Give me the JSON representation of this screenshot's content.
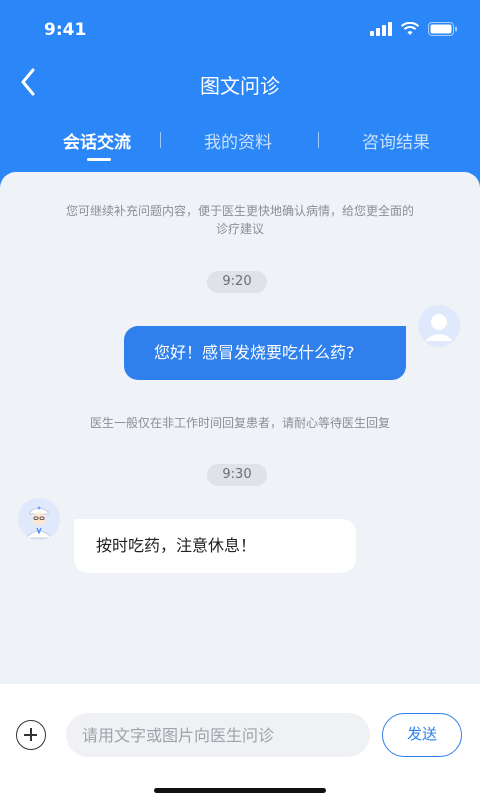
{
  "status_bar": {
    "time": "9:41"
  },
  "nav": {
    "title": "图文问诊"
  },
  "tabs": [
    {
      "label": "会话交流",
      "active": true
    },
    {
      "label": "我的资料",
      "active": false
    },
    {
      "label": "咨询结果",
      "active": false
    }
  ],
  "chat": {
    "notice_top_line1": "您可继续补充问题内容，便于医生更快地确认病情，给您更全面的",
    "notice_top_line2": "诊疗建议",
    "time1": "9:20",
    "user_message": "您好！感冒发烧要吃什么药?",
    "notice_middle": "医生一般仅在非工作时间回复患者，请耐心等待医生回复",
    "time2": "9:30",
    "doctor_message": "按时吃药，注意休息！"
  },
  "input_bar": {
    "placeholder": "请用文字或图片向医生问诊",
    "send_label": "发送"
  },
  "colors": {
    "primary": "#2b86f7",
    "bubble_user": "#2f80ed",
    "chat_bg": "#eff2f7"
  }
}
